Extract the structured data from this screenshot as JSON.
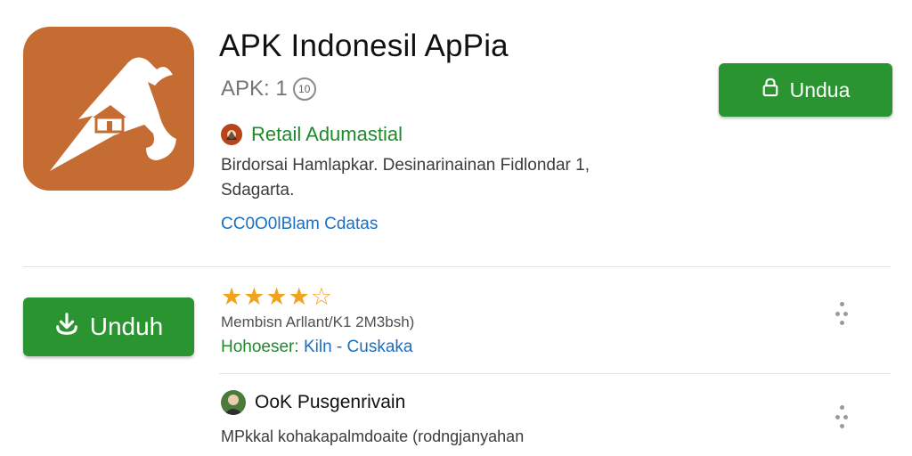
{
  "app": {
    "title": "APK Indonesil ApPia",
    "version_label": "APK: 1",
    "version_badge": "10",
    "developer": "Retail Adumastial",
    "description": "Birdorsai Hamlapkar. Desinarinainan Fidlondar 1, Sdagarta.",
    "link": "CC0O0lBlam Cdatas",
    "accent_color": "#2a9530",
    "icon_color": "#c56c33"
  },
  "actions": {
    "install_top_label": "Undua",
    "install_left_label": "Unduh"
  },
  "rating": {
    "stars": 4.5,
    "max_stars": 5,
    "meta": "Membisn Arllant/K1 2M3bsh)",
    "tag_primary": "Hohoeser:",
    "tag_separator_1": "Kiln",
    "tag_separator_2": "-",
    "tag_secondary": "Cuskaka"
  },
  "review": {
    "user": "OoK Pusgenrivain",
    "text": "MPkkal kohakapalmdoaite (rodngjanyahan"
  },
  "icons": {
    "app_logo": "mountain-house-logo-icon",
    "top_button": "lock-download-icon",
    "left_button": "download-arrow-icon",
    "more": "more-dots-icon"
  }
}
